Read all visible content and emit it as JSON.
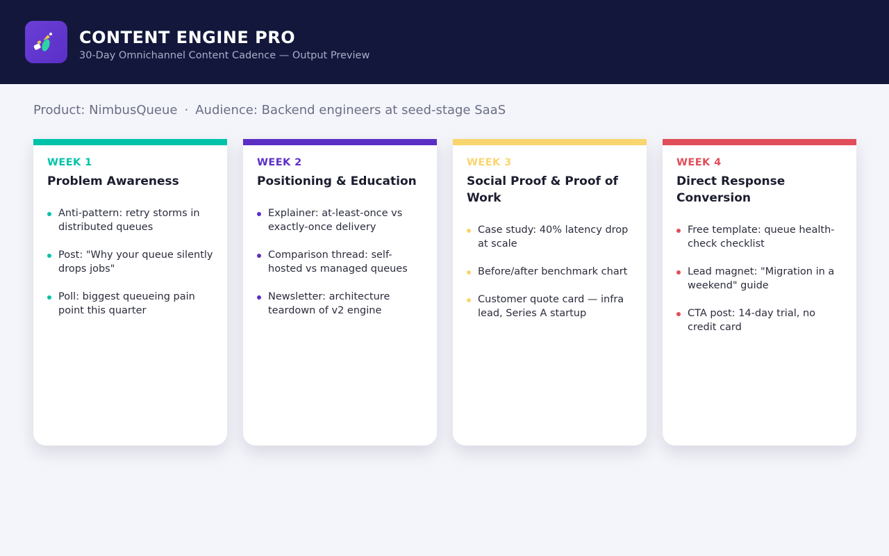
{
  "app": {
    "title": "CONTENT ENGINE PRO",
    "subtitle": "30-Day Omnichannel Content Cadence — Output Preview",
    "logo_icon": "rocket-icon"
  },
  "context": {
    "product": "Product: NimbusQueue",
    "separator": "·",
    "audience": "Audience: Backend engineers at seed-stage SaaS"
  },
  "weeks": [
    {
      "label": "WEEK 1",
      "title": "Problem Awareness",
      "color": "#00c2a8",
      "items": [
        "Anti-pattern: retry storms in distributed queues",
        "Post: \"Why your queue silently drops jobs\"",
        "Poll: biggest queueing pain point this quarter"
      ]
    },
    {
      "label": "WEEK 2",
      "title": "Positioning & Education",
      "color": "#5b2fc4",
      "items": [
        "Explainer: at-least-once vs exactly-once delivery",
        "Comparison thread: self-hosted vs managed queues",
        "Newsletter: architecture teardown of v2 engine"
      ]
    },
    {
      "label": "WEEK 3",
      "title": "Social Proof & Proof of Work",
      "color": "#f9d56e",
      "items": [
        "Case study: 40% latency drop at scale",
        "Before/after benchmark chart",
        "Customer quote card — infra lead, Series A startup"
      ]
    },
    {
      "label": "WEEK 4",
      "title": "Direct Response Conversion",
      "color": "#e04e5a",
      "items": [
        "Free template: queue health-check checklist",
        "Lead magnet: \"Migration in a weekend\" guide",
        "CTA post: 14-day trial, no credit card"
      ]
    }
  ]
}
